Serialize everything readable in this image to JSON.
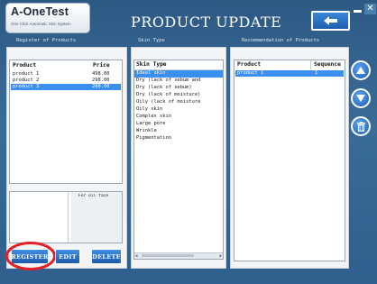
{
  "app": {
    "logo_title": "A-OneTest",
    "logo_subtitle": "One Click Automatic Skin System",
    "title": "PRODUCT UPDATE"
  },
  "icons": {
    "back": "back-arrow-icon",
    "minimize": "minimize-icon",
    "close": "close-icon"
  },
  "sections": {
    "register": "Register of Products",
    "skin_type": "Skin Type",
    "recommendation": "Recommendation of Products"
  },
  "register": {
    "col_product": "Product",
    "col_price": "Price",
    "rows": [
      {
        "product": "product 1",
        "price": "498.00",
        "selected": false
      },
      {
        "product": "product 2",
        "price": "298.00",
        "selected": false
      },
      {
        "product": "product 3",
        "price": "288.00",
        "selected": true
      }
    ],
    "detail_text": "For oil face",
    "buttons": {
      "register": "REGISTER",
      "edit": "EDIT",
      "delete": "DELETE"
    }
  },
  "skin_type": {
    "header": "Skin Type",
    "items": [
      {
        "label": "Ideal skin",
        "selected": true
      },
      {
        "label": "Dry (lack of sebum and",
        "selected": false
      },
      {
        "label": "Dry (lack of sebum)",
        "selected": false
      },
      {
        "label": "Dry (lack of moisture)",
        "selected": false
      },
      {
        "label": "Oily (lack of moisture",
        "selected": false
      },
      {
        "label": "Oily skin",
        "selected": false
      },
      {
        "label": "Complex skin",
        "selected": false
      },
      {
        "label": "Large pore",
        "selected": false
      },
      {
        "label": "Wrinkle",
        "selected": false
      },
      {
        "label": "Pigmentation",
        "selected": false
      }
    ]
  },
  "recommendation": {
    "col_product": "Product",
    "col_sequence": "Sequence",
    "rows": [
      {
        "product": "product 1",
        "sequence": "1",
        "selected": true
      }
    ]
  },
  "colors": {
    "accent": "#3b8ff0",
    "background": "#2f5f8c",
    "highlight_ring": "#e0202a"
  }
}
